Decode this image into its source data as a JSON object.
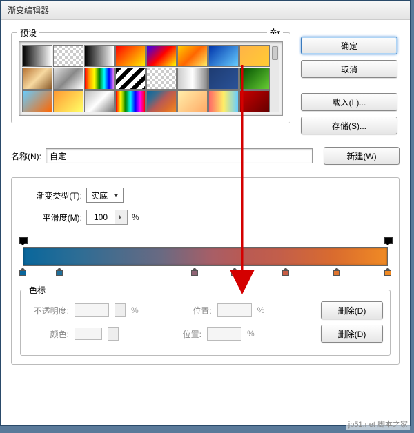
{
  "window": {
    "title": "渐变编辑器"
  },
  "presets": {
    "legend": "预设",
    "gear_icon": "gear",
    "swatches": [
      "linear-gradient(to right,#000,#fff)",
      "repeating-conic-gradient(#ccc 0 25%,#fff 0 50%) 0/8px 8px",
      "linear-gradient(to right,#000,#fff)",
      "linear-gradient(135deg,#ff0000,#ffee00)",
      "linear-gradient(135deg,#2a00ff,#ff0000,#ffff00)",
      "linear-gradient(135deg,#ffcc00,#ff6600,#ffee66)",
      "linear-gradient(135deg,#0033aa,#66ccff)",
      "linear-gradient(135deg,#ffb347,#ffcc33)",
      "linear-gradient(135deg,#b87333,#f7d9a0,#8a5a2a)",
      "linear-gradient(135deg,#e0e0e0,#888,#fff)",
      "linear-gradient(to right,red,orange,yellow,green,cyan,blue,violet)",
      "repeating-linear-gradient(135deg,#000 0 6px,#fff 6px 12px)",
      "repeating-conic-gradient(#ccc 0 25%,#fff 0 50%) 0/8px 8px",
      "linear-gradient(to right,#ccc,#fff,#888)",
      "linear-gradient(135deg,#1e3c72,#2a5298)",
      "linear-gradient(135deg,#004d00,#66cc33)",
      "linear-gradient(135deg,#66ccff,#ff6600)",
      "linear-gradient(135deg,#ff9933,#ffff66)",
      "linear-gradient(135deg,#bbb,#fff,#777)",
      "linear-gradient(to right,red,yellow,green,cyan,blue,magenta,red)",
      "linear-gradient(135deg,#09679c,#3d6c8e,#b85a54,#d96b2f,#f08a24)",
      "linear-gradient(135deg,#ffeeaa,#ffaa66)",
      "linear-gradient(to right,#ff6666,#ffee66,#66ccff)",
      "linear-gradient(135deg,#cc0000,#660000)"
    ]
  },
  "buttons": {
    "ok": "确定",
    "cancel": "取消",
    "load": "载入(L)...",
    "save": "存储(S)...",
    "new": "新建(W)"
  },
  "name": {
    "label": "名称(N):",
    "value": "自定"
  },
  "gradient": {
    "type_label": "渐变类型(T):",
    "type_value": "实底",
    "smooth_label": "平滑度(M):",
    "smooth_value": "100",
    "smooth_unit": "%",
    "bar_css": "linear-gradient(to right,#09679c 0%,#2d6d95 15%,#6a6a82 38%,#a85e66 52%,#b85a54 60%,#c25e4b 70%,#d96b2f 85%,#f08a24 100%)",
    "opacity_stops": [
      {
        "pos": 0
      },
      {
        "pos": 100
      }
    ],
    "color_stops": [
      {
        "pos": 0,
        "color": "#0a679c"
      },
      {
        "pos": 10,
        "color": "#1f6f9a"
      },
      {
        "pos": 47,
        "color": "#8f6374"
      },
      {
        "pos": 58,
        "color": "#b45a58"
      },
      {
        "pos": 72,
        "color": "#c85c44"
      },
      {
        "pos": 86,
        "color": "#e0742e"
      },
      {
        "pos": 100,
        "color": "#f08a24"
      }
    ]
  },
  "stops_panel": {
    "legend": "色标",
    "opacity_label": "不透明度:",
    "opacity_unit": "%",
    "position_label": "位置:",
    "position_unit": "%",
    "delete_label": "删除(D)",
    "color_label": "颜色:"
  },
  "watermark": "jb51.net  脚本之家"
}
